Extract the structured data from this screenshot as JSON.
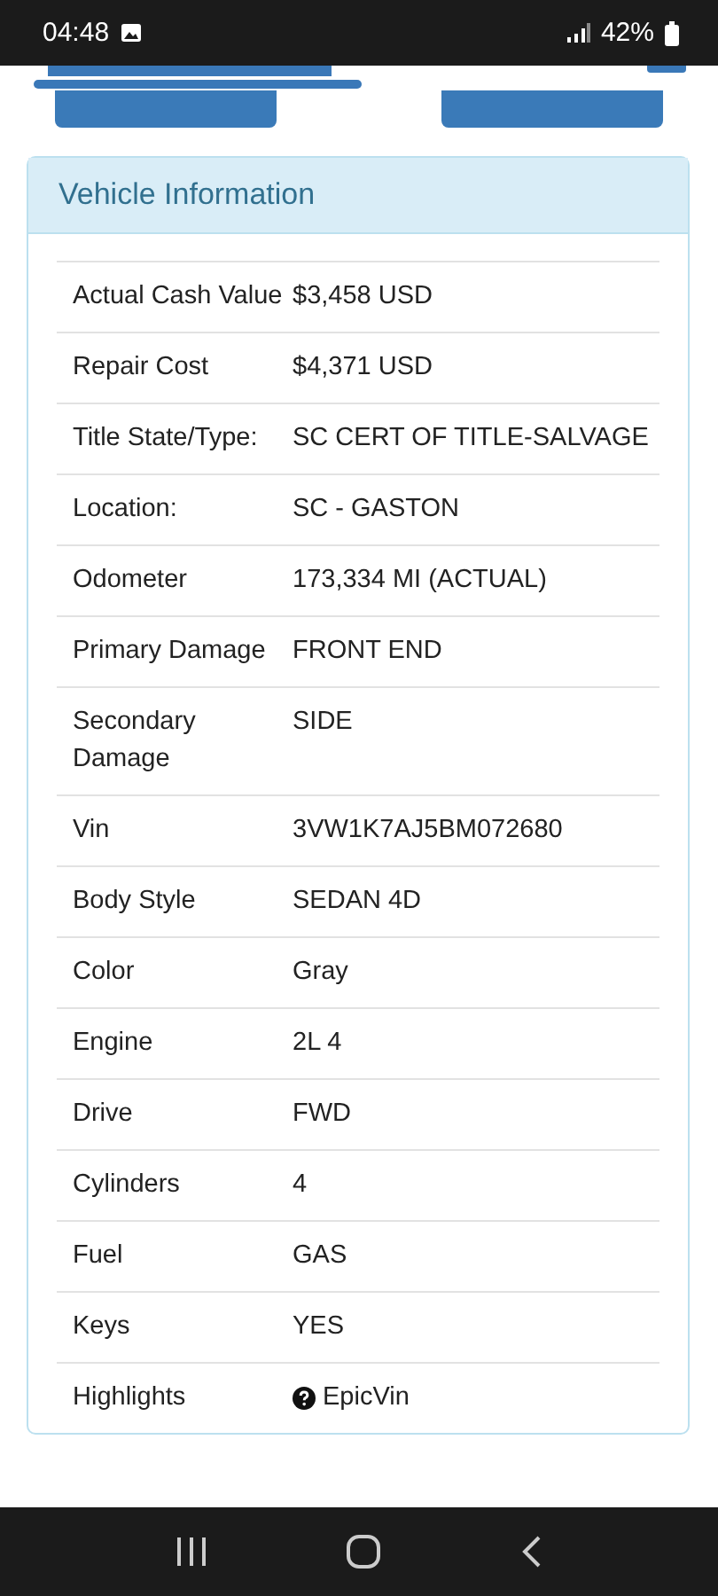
{
  "status_bar": {
    "time": "04:48",
    "battery": "42%"
  },
  "card": {
    "title": "Vehicle Information",
    "rows": [
      {
        "label": "Actual Cash Value",
        "value": "$3,458 USD"
      },
      {
        "label": "Repair Cost",
        "value": "$4,371 USD"
      },
      {
        "label": "Title State/Type:",
        "value": "SC CERT OF TITLE-SALVAGE"
      },
      {
        "label": "Location:",
        "value": "SC - GASTON"
      },
      {
        "label": "Odometer",
        "value": "173,334 MI (ACTUAL)"
      },
      {
        "label": "Primary Damage",
        "value": "FRONT END"
      },
      {
        "label": "Secondary Damage",
        "value": "SIDE"
      },
      {
        "label": "Vin",
        "value": "3VW1K7AJ5BM072680"
      },
      {
        "label": "Body Style",
        "value": "SEDAN 4D"
      },
      {
        "label": "Color",
        "value": "Gray"
      },
      {
        "label": "Engine",
        "value": "2L 4"
      },
      {
        "label": "Drive",
        "value": "FWD"
      },
      {
        "label": "Cylinders",
        "value": "4"
      },
      {
        "label": "Fuel",
        "value": "GAS"
      },
      {
        "label": "Keys",
        "value": "YES"
      },
      {
        "label": "Highlights",
        "value": "EpicVin",
        "kind": "help-link"
      }
    ]
  }
}
